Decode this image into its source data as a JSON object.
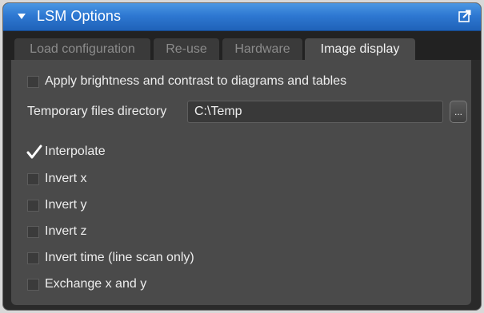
{
  "panel": {
    "title": "LSM Options",
    "icons": {
      "collapse": "triangle-down-icon",
      "popout": "popout-window-icon"
    }
  },
  "tabs": [
    {
      "label": "Load configuration",
      "active": false
    },
    {
      "label": "Re-use",
      "active": false
    },
    {
      "label": "Hardware",
      "active": false
    },
    {
      "label": "Image display",
      "active": true
    }
  ],
  "options": {
    "apply_brightness": {
      "label": "Apply brightness and contrast to diagrams and tables",
      "checked": false
    },
    "temp_dir": {
      "label": "Temporary files directory",
      "value": "C:\\Temp",
      "browse_label": "..."
    },
    "interpolate": {
      "label": "Interpolate",
      "checked": true
    },
    "invert_x": {
      "label": "Invert x",
      "checked": false
    },
    "invert_y": {
      "label": "Invert y",
      "checked": false
    },
    "invert_z": {
      "label": "Invert z",
      "checked": false
    },
    "invert_time": {
      "label": "Invert time (line scan only)",
      "checked": false
    },
    "exchange_xy": {
      "label": "Exchange x and y",
      "checked": false
    }
  },
  "colors": {
    "title_bar": "#2e78d2",
    "panel_bg": "#4a4a4a",
    "text": "#ededed"
  }
}
